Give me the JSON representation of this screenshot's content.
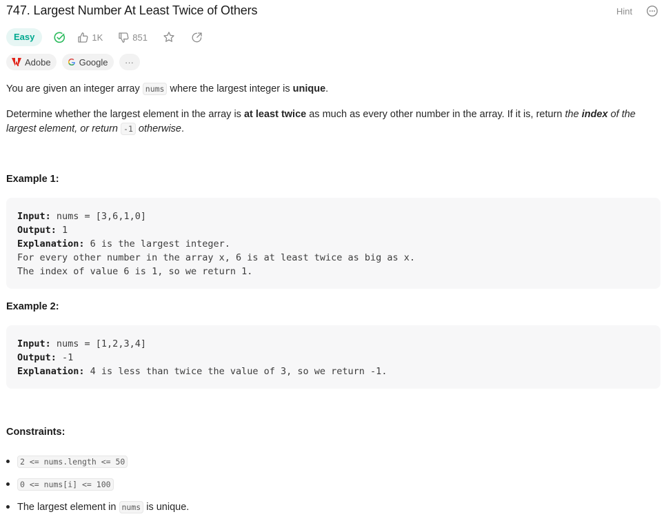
{
  "problem": {
    "title": "747. Largest Number At Least Twice of Others",
    "hint_label": "Hint"
  },
  "meta": {
    "difficulty": "Easy",
    "likes": "1K",
    "dislikes": "851"
  },
  "tags": {
    "adobe": "Adobe",
    "google": "Google",
    "more": "···"
  },
  "description": {
    "p1_a": "You are given an integer array ",
    "p1_code": "nums",
    "p1_b": " where the largest integer is ",
    "p1_bold": "unique",
    "p1_c": ".",
    "p2_a": "Determine whether the largest element in the array is ",
    "p2_bold": "at least twice",
    "p2_b": " as much as every other number in the array. If it is, return ",
    "p2_i1": "the ",
    "p2_ib": "index",
    "p2_i2": " of the largest element, or return ",
    "p2_code": "-1",
    "p2_i3": " otherwise",
    "p2_c": "."
  },
  "examples": [
    {
      "heading": "Example 1:",
      "input_label": "Input:",
      "input": " nums = [3,6,1,0]",
      "output_label": "Output:",
      "output": " 1",
      "explanation_label": "Explanation:",
      "explanation": " 6 is the largest integer.",
      "extra1": "For every other number in the array x, 6 is at least twice as big as x.",
      "extra2": "The index of value 6 is 1, so we return 1."
    },
    {
      "heading": "Example 2:",
      "input_label": "Input:",
      "input": " nums = [1,2,3,4]",
      "output_label": "Output:",
      "output": " -1",
      "explanation_label": "Explanation:",
      "explanation": " 4 is less than twice the value of 3, so we return -1."
    }
  ],
  "constraints": {
    "heading": "Constraints:",
    "c1": "2 <= nums.length <= 50",
    "c2": "0 <= nums[i] <= 100",
    "c3_a": "The largest element in ",
    "c3_code": "nums",
    "c3_b": " is unique."
  },
  "colors": {
    "easy": "#00a88f",
    "easy_bg": "#e7f6f4",
    "solved_check": "#2cbb5d",
    "muted": "#8c8c8c"
  },
  "icons": [
    "solved-check-icon",
    "thumbs-up-icon",
    "thumbs-down-icon",
    "star-icon",
    "share-icon",
    "more-icon",
    "adobe-logo",
    "google-logo"
  ]
}
